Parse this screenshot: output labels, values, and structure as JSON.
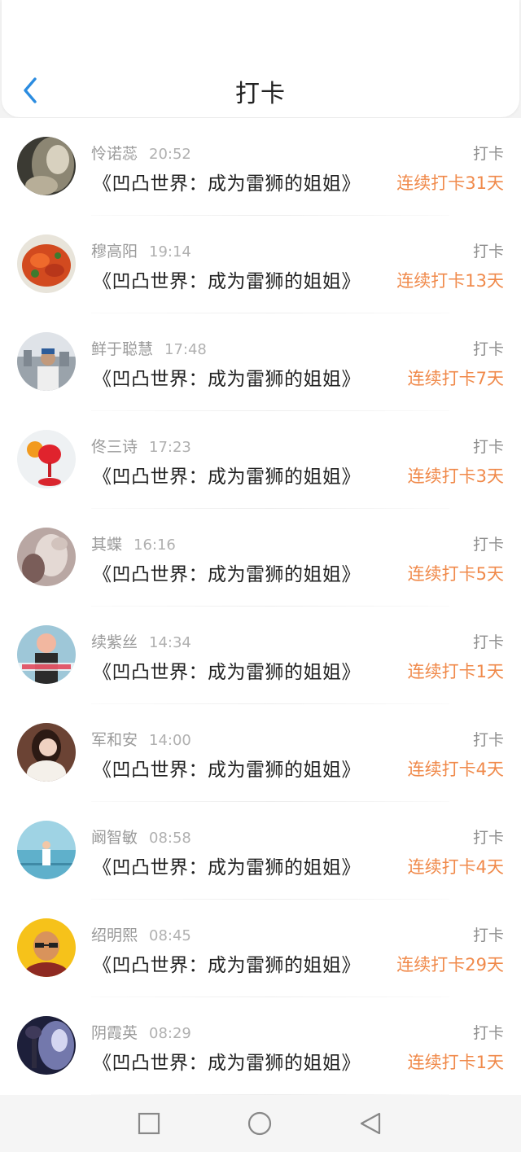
{
  "header": {
    "title": "打卡"
  },
  "checkins": [
    {
      "name": "怜诺蕊",
      "time": "20:52",
      "book": "《凹凸世界：成为雷狮的姐姐》",
      "action": "打卡",
      "streak": "连续打卡31天"
    },
    {
      "name": "穆高阳",
      "time": "19:14",
      "book": "《凹凸世界：成为雷狮的姐姐》",
      "action": "打卡",
      "streak": "连续打卡13天"
    },
    {
      "name": "鲜于聪慧",
      "time": "17:48",
      "book": "《凹凸世界：成为雷狮的姐姐》",
      "action": "打卡",
      "streak": "连续打卡7天"
    },
    {
      "name": "佟三诗",
      "time": "17:23",
      "book": "《凹凸世界：成为雷狮的姐姐》",
      "action": "打卡",
      "streak": "连续打卡3天"
    },
    {
      "name": "其蝶",
      "time": "16:16",
      "book": "《凹凸世界：成为雷狮的姐姐》",
      "action": "打卡",
      "streak": "连续打卡5天"
    },
    {
      "name": "续紫丝",
      "time": "14:34",
      "book": "《凹凸世界：成为雷狮的姐姐》",
      "action": "打卡",
      "streak": "连续打卡1天"
    },
    {
      "name": "军和安",
      "time": "14:00",
      "book": "《凹凸世界：成为雷狮的姐姐》",
      "action": "打卡",
      "streak": "连续打卡4天"
    },
    {
      "name": "阚智敏",
      "time": "08:58",
      "book": "《凹凸世界：成为雷狮的姐姐》",
      "action": "打卡",
      "streak": "连续打卡4天"
    },
    {
      "name": "绍明熙",
      "time": "08:45",
      "book": "《凹凸世界：成为雷狮的姐姐》",
      "action": "打卡",
      "streak": "连续打卡29天"
    },
    {
      "name": "阴霞英",
      "time": "08:29",
      "book": "《凹凸世界：成为雷狮的姐姐》",
      "action": "打卡",
      "streak": "连续打卡1天"
    }
  ],
  "colors": {
    "accent": "#2b8ce0",
    "streak": "#f08a4b",
    "name": "#9a9a9a",
    "title": "#222222"
  },
  "icons": {
    "back": "chevron-left-icon",
    "nav_recent": "square-icon",
    "nav_home": "circle-icon",
    "nav_back": "triangle-back-icon"
  }
}
